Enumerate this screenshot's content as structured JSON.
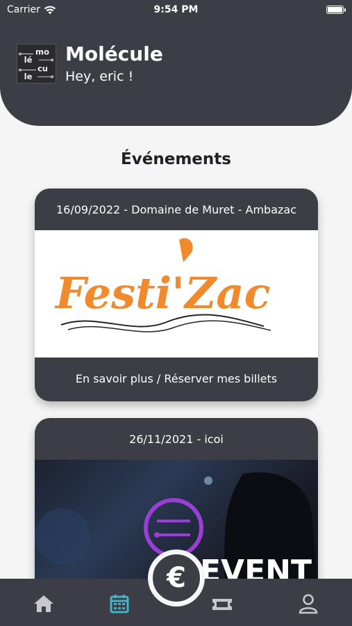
{
  "status_bar": {
    "carrier": "Carrier",
    "time": "9:54 PM"
  },
  "header": {
    "app_title": "Molécule",
    "greeting": "Hey, eric !",
    "logo_lines": [
      "mo",
      "lé",
      "cu",
      "le"
    ]
  },
  "section_title": "Événements",
  "events": [
    {
      "header": "16/09/2022 - Domaine de Muret - Ambazac",
      "image_text": "Festi'Zac",
      "footer": "En savoir plus / Réserver mes billets"
    },
    {
      "header": "26/11/2021 - icoi",
      "image_text": "EVENT"
    }
  ],
  "tabs": [
    "home-icon",
    "calendar-icon",
    "euro-icon",
    "ticket-icon",
    "user-icon"
  ],
  "colors": {
    "dark": "#3d3d45",
    "accent": "#3fb6c8",
    "orange": "#f08a2c",
    "background": "#f5f5f5"
  }
}
